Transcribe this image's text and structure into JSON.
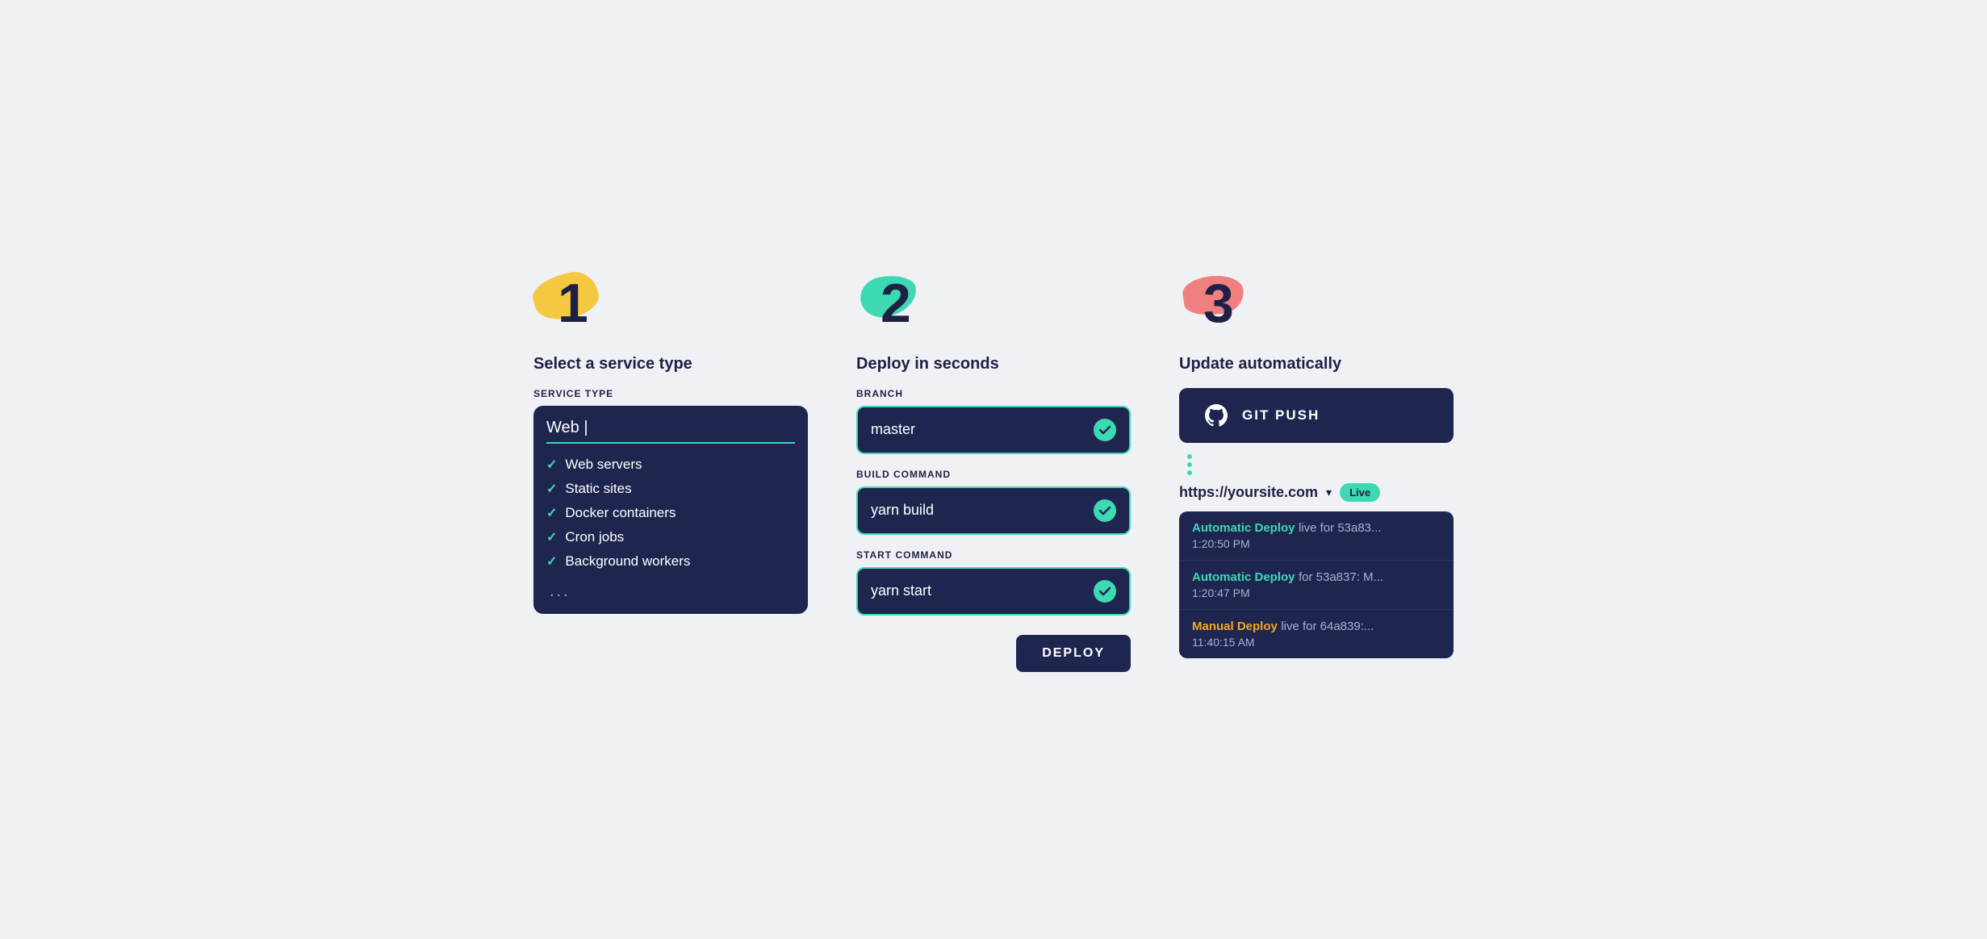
{
  "col1": {
    "step": "1",
    "title": "Select a service type",
    "label": "SERVICE TYPE",
    "input_value": "Web",
    "items": [
      "Web servers",
      "Static sites",
      "Docker containers",
      "Cron jobs",
      "Background workers"
    ],
    "more": "..."
  },
  "col2": {
    "step": "2",
    "title": "Deploy in seconds",
    "branch_label": "BRANCH",
    "branch_value": "master",
    "build_label": "BUILD COMMAND",
    "build_value": "yarn build",
    "start_label": "START COMMAND",
    "start_value": "yarn start",
    "deploy_btn": "DEPLOY"
  },
  "col3": {
    "step": "3",
    "title": "Update automatically",
    "git_push_label": "GIT PUSH",
    "site_url": "https://yoursite.com",
    "live_badge": "Live",
    "logs": [
      {
        "type": "Automatic Deploy",
        "type_style": "auto",
        "desc": " live for 53a83...",
        "time": "1:20:50 PM"
      },
      {
        "type": "Automatic Deploy",
        "type_style": "auto",
        "desc": " for 53a837: M...",
        "time": "1:20:47 PM"
      },
      {
        "type": "Manual Deploy",
        "type_style": "manual",
        "desc": " live for 64a839:...",
        "time": "11:40:15 AM"
      }
    ]
  }
}
